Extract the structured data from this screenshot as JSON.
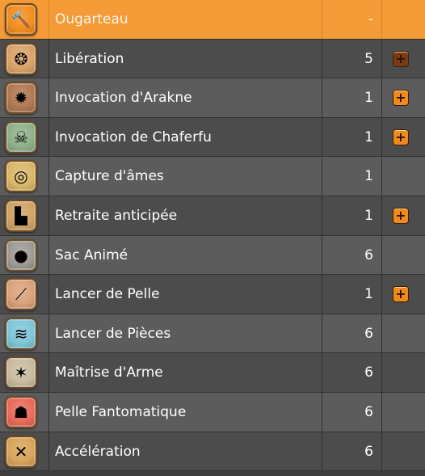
{
  "spells": [
    {
      "name": "Ougarteau",
      "level": "-",
      "icon": "hammer-icon",
      "icon_bg": "#f28e1f",
      "upgradable": false,
      "selected": true,
      "glyph": "🔨"
    },
    {
      "name": "Libération",
      "level": "5",
      "icon": "liberation-icon",
      "icon_bg": "#d8a36a",
      "upgradable": true,
      "upgrade_style": "dark",
      "glyph": "❂"
    },
    {
      "name": "Invocation d'Arakne",
      "level": "1",
      "icon": "arakne-icon",
      "icon_bg": "#b07a52",
      "upgradable": true,
      "glyph": "✹"
    },
    {
      "name": "Invocation de Chaferfu",
      "level": "1",
      "icon": "chaferfu-icon",
      "icon_bg": "#8fb08a",
      "upgradable": true,
      "glyph": "☠"
    },
    {
      "name": "Capture d'âmes",
      "level": "1",
      "icon": "capture-ames-icon",
      "icon_bg": "#d9b76a",
      "upgradable": false,
      "glyph": "◎"
    },
    {
      "name": "Retraite anticipée",
      "level": "1",
      "icon": "retraite-icon",
      "icon_bg": "#cfa465",
      "upgradable": true,
      "glyph": "▙"
    },
    {
      "name": "Sac Animé",
      "level": "6",
      "icon": "sac-anime-icon",
      "icon_bg": "#9e9a94",
      "upgradable": false,
      "glyph": "●"
    },
    {
      "name": "Lancer de Pelle",
      "level": "1",
      "icon": "lancer-pelle-icon",
      "icon_bg": "#d9a27a",
      "upgradable": true,
      "glyph": "⟋"
    },
    {
      "name": "Lancer de Pièces",
      "level": "6",
      "icon": "lancer-pieces-icon",
      "icon_bg": "#7fc6d6",
      "upgradable": false,
      "glyph": "≋"
    },
    {
      "name": "Maîtrise d'Arme",
      "level": "6",
      "icon": "maitrise-arme-icon",
      "icon_bg": "#c8bba0",
      "upgradable": false,
      "glyph": "✶"
    },
    {
      "name": "Pelle Fantomatique",
      "level": "6",
      "icon": "pelle-fantomatique-icon",
      "icon_bg": "#e86a5a",
      "upgradable": false,
      "glyph": "☗"
    },
    {
      "name": "Accélération",
      "level": "6",
      "icon": "acceleration-icon",
      "icon_bg": "#d8a45a",
      "upgradable": false,
      "glyph": "✕"
    }
  ]
}
